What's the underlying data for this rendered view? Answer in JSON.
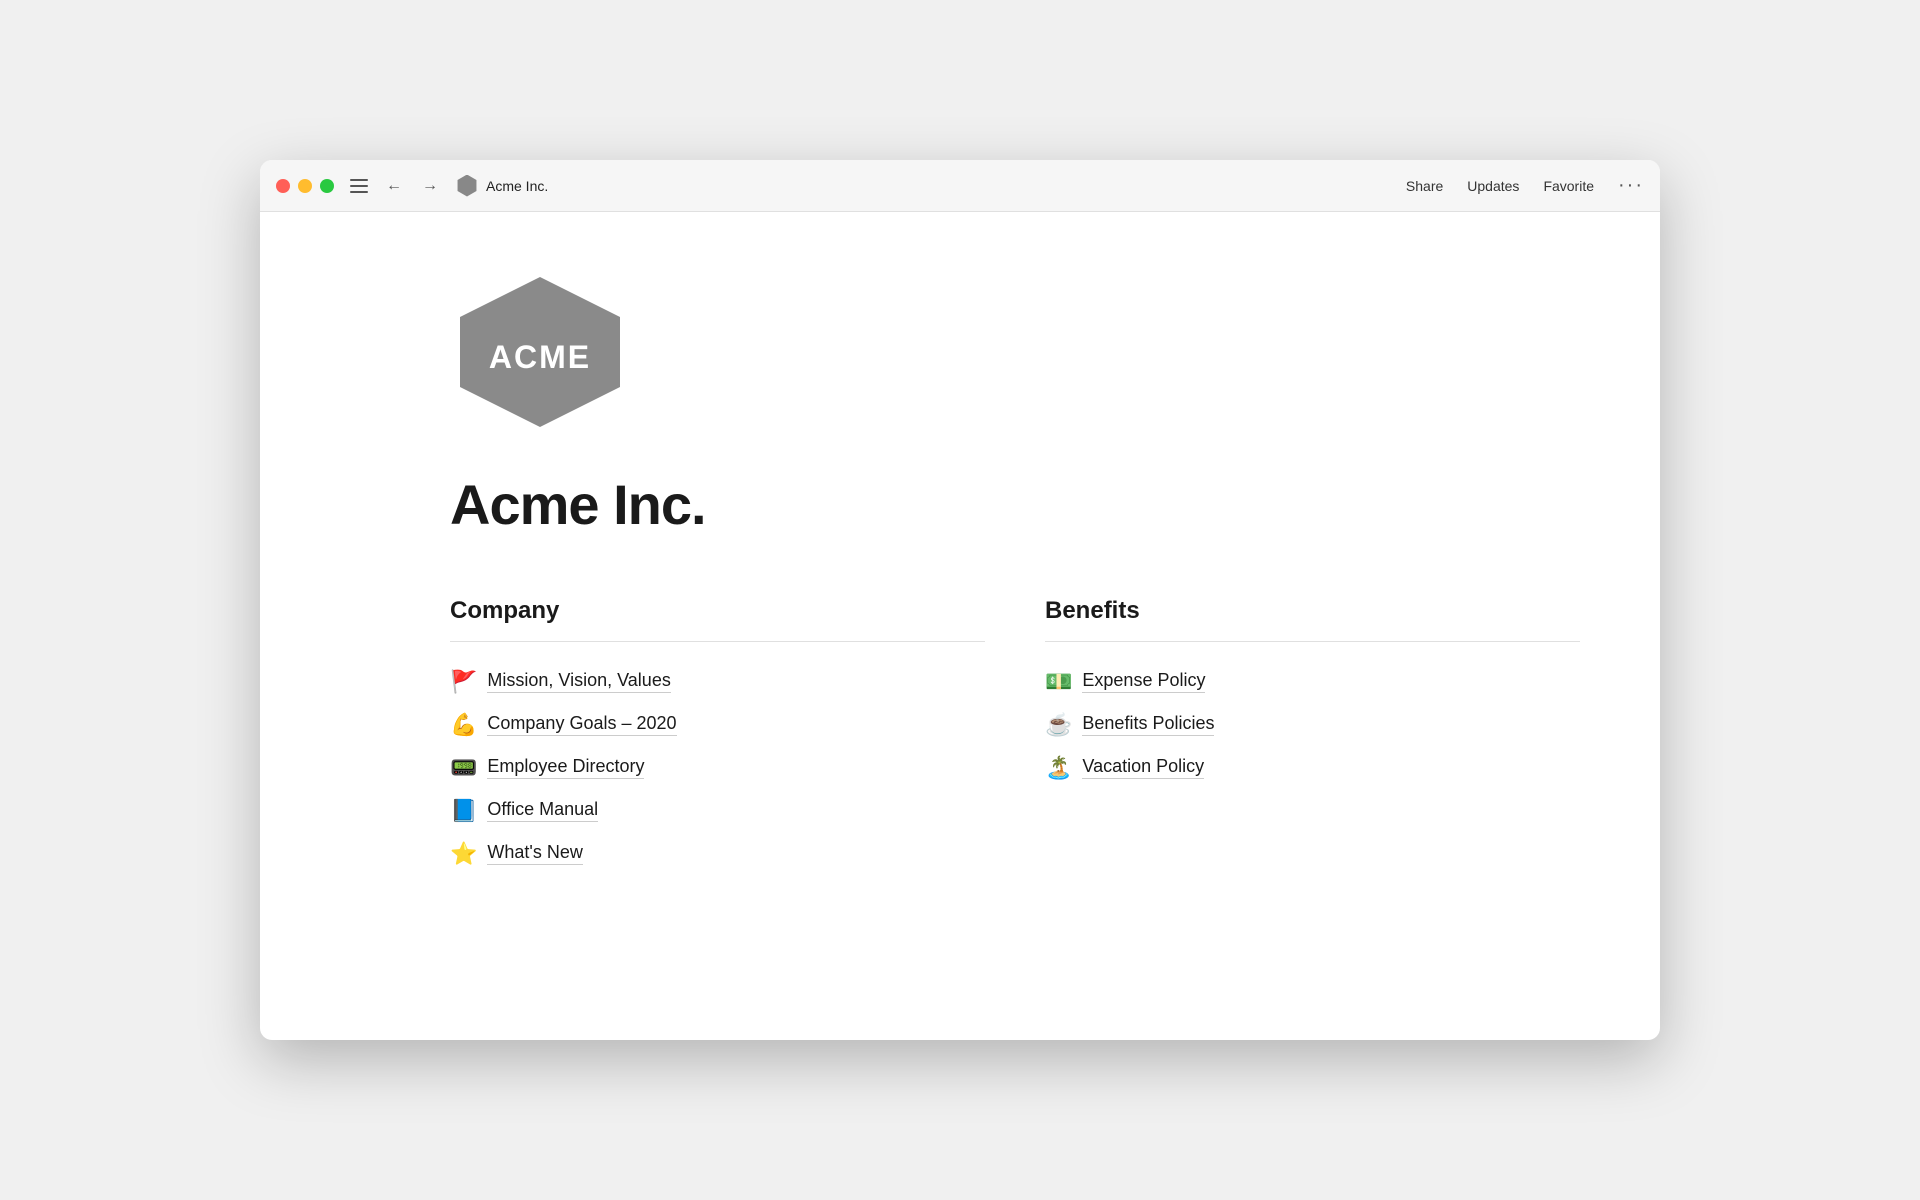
{
  "titleBar": {
    "title": "Acme Inc.",
    "shareLabel": "Share",
    "updatesLabel": "Updates",
    "favoriteLabel": "Favorite"
  },
  "page": {
    "title": "Acme Inc."
  },
  "sections": {
    "company": {
      "heading": "Company",
      "items": [
        {
          "emoji": "🚩",
          "label": "Mission, Vision, Values"
        },
        {
          "emoji": "💪",
          "label": "Company Goals – 2020"
        },
        {
          "emoji": "📟",
          "label": "Employee Directory"
        },
        {
          "emoji": "📘",
          "label": "Office Manual"
        },
        {
          "emoji": "⭐",
          "label": "What's New"
        }
      ]
    },
    "benefits": {
      "heading": "Benefits",
      "items": [
        {
          "emoji": "💵",
          "label": "Expense Policy"
        },
        {
          "emoji": "☕",
          "label": "Benefits Policies"
        },
        {
          "emoji": "🏝️",
          "label": "Vacation Policy"
        }
      ]
    }
  }
}
